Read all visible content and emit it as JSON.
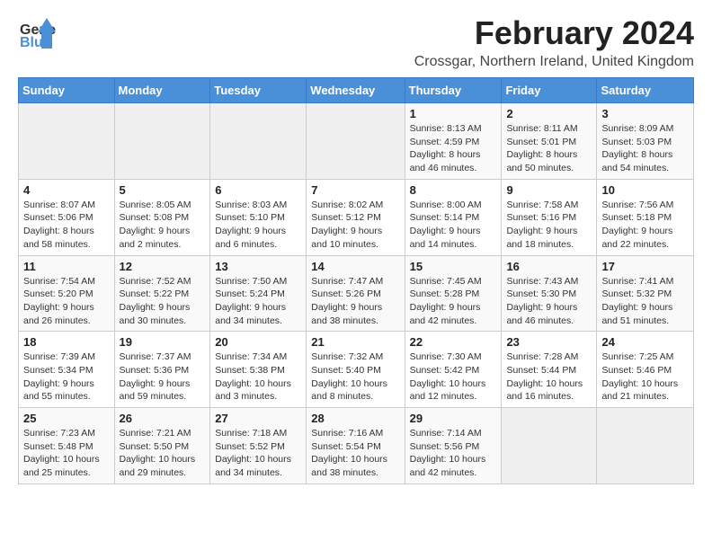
{
  "header": {
    "logo_text_general": "General",
    "logo_text_blue": "Blue",
    "title": "February 2024",
    "subtitle": "Crossgar, Northern Ireland, United Kingdom"
  },
  "weekdays": [
    "Sunday",
    "Monday",
    "Tuesday",
    "Wednesday",
    "Thursday",
    "Friday",
    "Saturday"
  ],
  "weeks": [
    [
      {
        "day": "",
        "info": ""
      },
      {
        "day": "",
        "info": ""
      },
      {
        "day": "",
        "info": ""
      },
      {
        "day": "",
        "info": ""
      },
      {
        "day": "1",
        "info": "Sunrise: 8:13 AM\nSunset: 4:59 PM\nDaylight: 8 hours\nand 46 minutes."
      },
      {
        "day": "2",
        "info": "Sunrise: 8:11 AM\nSunset: 5:01 PM\nDaylight: 8 hours\nand 50 minutes."
      },
      {
        "day": "3",
        "info": "Sunrise: 8:09 AM\nSunset: 5:03 PM\nDaylight: 8 hours\nand 54 minutes."
      }
    ],
    [
      {
        "day": "4",
        "info": "Sunrise: 8:07 AM\nSunset: 5:06 PM\nDaylight: 8 hours\nand 58 minutes."
      },
      {
        "day": "5",
        "info": "Sunrise: 8:05 AM\nSunset: 5:08 PM\nDaylight: 9 hours\nand 2 minutes."
      },
      {
        "day": "6",
        "info": "Sunrise: 8:03 AM\nSunset: 5:10 PM\nDaylight: 9 hours\nand 6 minutes."
      },
      {
        "day": "7",
        "info": "Sunrise: 8:02 AM\nSunset: 5:12 PM\nDaylight: 9 hours\nand 10 minutes."
      },
      {
        "day": "8",
        "info": "Sunrise: 8:00 AM\nSunset: 5:14 PM\nDaylight: 9 hours\nand 14 minutes."
      },
      {
        "day": "9",
        "info": "Sunrise: 7:58 AM\nSunset: 5:16 PM\nDaylight: 9 hours\nand 18 minutes."
      },
      {
        "day": "10",
        "info": "Sunrise: 7:56 AM\nSunset: 5:18 PM\nDaylight: 9 hours\nand 22 minutes."
      }
    ],
    [
      {
        "day": "11",
        "info": "Sunrise: 7:54 AM\nSunset: 5:20 PM\nDaylight: 9 hours\nand 26 minutes."
      },
      {
        "day": "12",
        "info": "Sunrise: 7:52 AM\nSunset: 5:22 PM\nDaylight: 9 hours\nand 30 minutes."
      },
      {
        "day": "13",
        "info": "Sunrise: 7:50 AM\nSunset: 5:24 PM\nDaylight: 9 hours\nand 34 minutes."
      },
      {
        "day": "14",
        "info": "Sunrise: 7:47 AM\nSunset: 5:26 PM\nDaylight: 9 hours\nand 38 minutes."
      },
      {
        "day": "15",
        "info": "Sunrise: 7:45 AM\nSunset: 5:28 PM\nDaylight: 9 hours\nand 42 minutes."
      },
      {
        "day": "16",
        "info": "Sunrise: 7:43 AM\nSunset: 5:30 PM\nDaylight: 9 hours\nand 46 minutes."
      },
      {
        "day": "17",
        "info": "Sunrise: 7:41 AM\nSunset: 5:32 PM\nDaylight: 9 hours\nand 51 minutes."
      }
    ],
    [
      {
        "day": "18",
        "info": "Sunrise: 7:39 AM\nSunset: 5:34 PM\nDaylight: 9 hours\nand 55 minutes."
      },
      {
        "day": "19",
        "info": "Sunrise: 7:37 AM\nSunset: 5:36 PM\nDaylight: 9 hours\nand 59 minutes."
      },
      {
        "day": "20",
        "info": "Sunrise: 7:34 AM\nSunset: 5:38 PM\nDaylight: 10 hours\nand 3 minutes."
      },
      {
        "day": "21",
        "info": "Sunrise: 7:32 AM\nSunset: 5:40 PM\nDaylight: 10 hours\nand 8 minutes."
      },
      {
        "day": "22",
        "info": "Sunrise: 7:30 AM\nSunset: 5:42 PM\nDaylight: 10 hours\nand 12 minutes."
      },
      {
        "day": "23",
        "info": "Sunrise: 7:28 AM\nSunset: 5:44 PM\nDaylight: 10 hours\nand 16 minutes."
      },
      {
        "day": "24",
        "info": "Sunrise: 7:25 AM\nSunset: 5:46 PM\nDaylight: 10 hours\nand 21 minutes."
      }
    ],
    [
      {
        "day": "25",
        "info": "Sunrise: 7:23 AM\nSunset: 5:48 PM\nDaylight: 10 hours\nand 25 minutes."
      },
      {
        "day": "26",
        "info": "Sunrise: 7:21 AM\nSunset: 5:50 PM\nDaylight: 10 hours\nand 29 minutes."
      },
      {
        "day": "27",
        "info": "Sunrise: 7:18 AM\nSunset: 5:52 PM\nDaylight: 10 hours\nand 34 minutes."
      },
      {
        "day": "28",
        "info": "Sunrise: 7:16 AM\nSunset: 5:54 PM\nDaylight: 10 hours\nand 38 minutes."
      },
      {
        "day": "29",
        "info": "Sunrise: 7:14 AM\nSunset: 5:56 PM\nDaylight: 10 hours\nand 42 minutes."
      },
      {
        "day": "",
        "info": ""
      },
      {
        "day": "",
        "info": ""
      }
    ]
  ]
}
